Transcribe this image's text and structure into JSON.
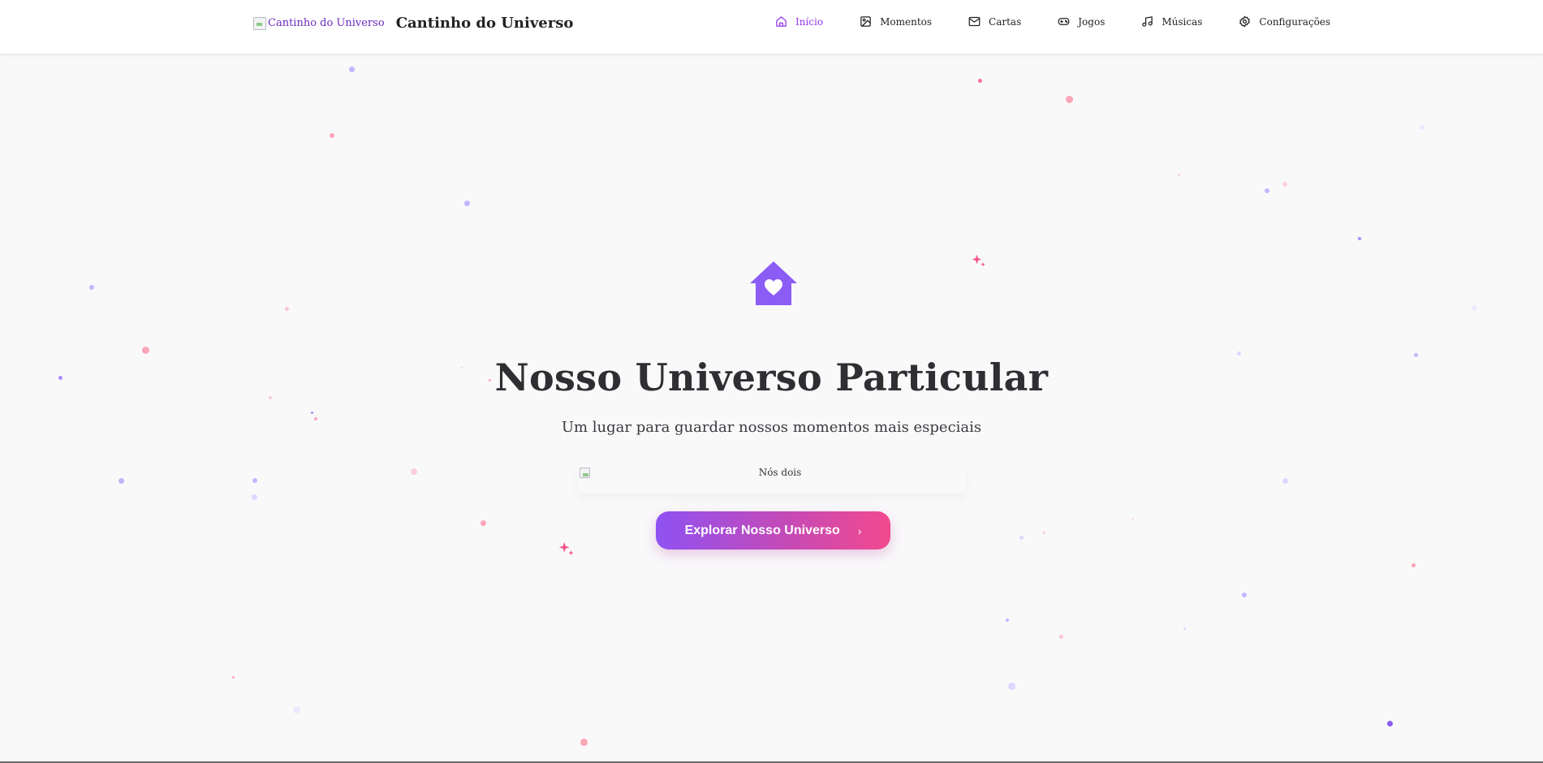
{
  "header": {
    "logo_alt": "Cantinho do Universo",
    "site_title": "Cantinho do Universo",
    "nav": [
      {
        "label": "Início",
        "icon": "home-icon",
        "active": true
      },
      {
        "label": "Momentos",
        "icon": "image-icon",
        "active": false
      },
      {
        "label": "Cartas",
        "icon": "mail-icon",
        "active": false
      },
      {
        "label": "Jogos",
        "icon": "gamepad-icon",
        "active": false
      },
      {
        "label": "Músicas",
        "icon": "music-icon",
        "active": false
      },
      {
        "label": "Configurações",
        "icon": "settings-icon",
        "active": false
      }
    ]
  },
  "hero": {
    "icon": "home-heart-icon",
    "title": "Nosso Universo Particular",
    "subtitle": "Um lugar para guardar nossos momentos mais especiais",
    "photo_alt": "Nós dois",
    "cta_label": "Explorar Nosso Universo"
  },
  "colors": {
    "accent": "#9333ea",
    "accent_pink": "#f2498e",
    "icon_purple": "#8b5cf6"
  }
}
